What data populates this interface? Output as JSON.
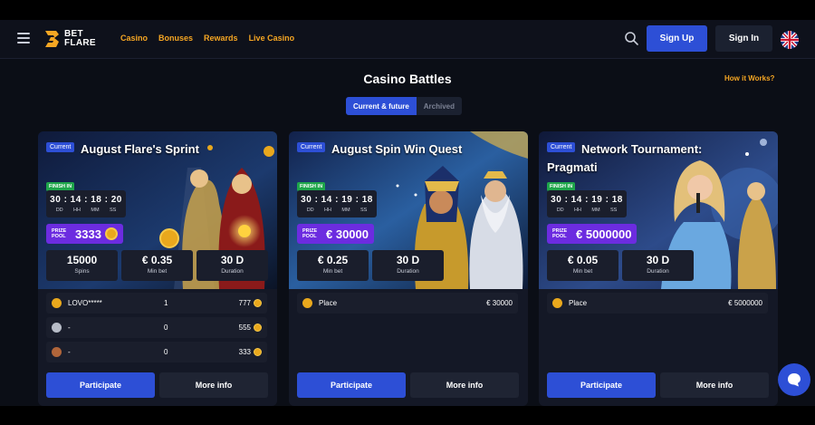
{
  "header": {
    "logo_line1": "BET",
    "logo_line2": "FLARE",
    "nav": [
      "Casino",
      "Bonuses",
      "Rewards",
      "Live Casino"
    ],
    "signup": "Sign Up",
    "signin": "Sign In"
  },
  "page": {
    "title": "Casino Battles",
    "how_it_works": "How it Works?",
    "tabs": [
      "Current & future",
      "Archived"
    ]
  },
  "colors": {
    "accent": "#2d4fd6",
    "nav": "#f5a623",
    "prize": "#6c2ce0",
    "finish": "#1fa64b"
  },
  "cards": [
    {
      "badge": "Current",
      "title": "August Flare's Sprint",
      "finish_label": "FINISH IN",
      "timer": "30 : 14 : 18 : 20",
      "timer_units": [
        "DD",
        "HH",
        "MM",
        "SS"
      ],
      "prize_label": "PRIZE POOL",
      "prize_value": "3333",
      "stats": [
        {
          "value": "15000",
          "label": "Spins"
        },
        {
          "value": "€ 0.35",
          "label": "Min bet"
        },
        {
          "value": "30 D",
          "label": "Duration"
        }
      ],
      "rows": [
        {
          "name": "LOVO*****",
          "num": "1",
          "prize": "777"
        },
        {
          "name": "-",
          "num": "0",
          "prize": "555"
        },
        {
          "name": "-",
          "num": "0",
          "prize": "333"
        }
      ],
      "participate": "Participate",
      "more": "More info"
    },
    {
      "badge": "Current",
      "title": "August Spin Win Quest",
      "finish_label": "FINISH IN",
      "timer": "30 : 14 : 19 : 18",
      "timer_units": [
        "DD",
        "HH",
        "MM",
        "SS"
      ],
      "prize_label": "PRIZE POOL",
      "prize_value": "€ 30000",
      "stats": [
        {
          "value": "€ 0.25",
          "label": "Min bet"
        },
        {
          "value": "30 D",
          "label": "Duration"
        }
      ],
      "rows": [
        {
          "name": "Place",
          "prize": "€ 30000"
        }
      ],
      "participate": "Participate",
      "more": "More info"
    },
    {
      "badge": "Current",
      "title": "Network Tournament: Pragmati",
      "finish_label": "FINISH IN",
      "timer": "30 : 14 : 19 : 18",
      "timer_units": [
        "DD",
        "HH",
        "MM",
        "SS"
      ],
      "prize_label": "PRIZE POOL",
      "prize_value": "€ 5000000",
      "stats": [
        {
          "value": "€ 0.05",
          "label": "Min bet"
        },
        {
          "value": "30 D",
          "label": "Duration"
        }
      ],
      "rows": [
        {
          "name": "Place",
          "prize": "€ 5000000"
        }
      ],
      "participate": "Participate",
      "more": "More info"
    }
  ]
}
